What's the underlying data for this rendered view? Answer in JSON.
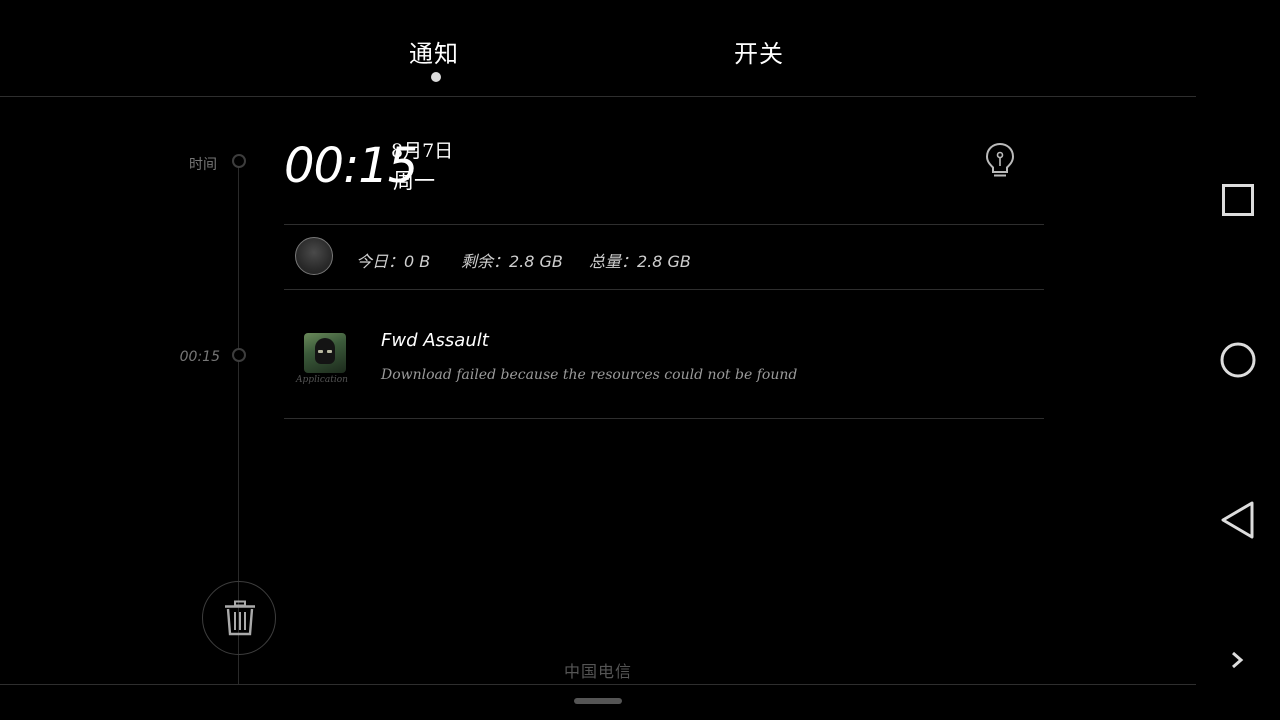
{
  "tabs": {
    "notifications": "通知",
    "switches": "开关"
  },
  "timeline": {
    "time_label": "时间",
    "entry_time": "00:15"
  },
  "header": {
    "time": "00:15",
    "date": "8月7日",
    "weekday": "周一"
  },
  "storage": {
    "today": "今日：0 B",
    "remaining": "剩余：2.8 GB",
    "total": "总量：2.8 GB"
  },
  "notification": {
    "title": "Fwd Assault",
    "message": "Download failed because the resources could not be found",
    "icon_caption": "Application"
  },
  "footer": {
    "carrier": "中国电信"
  },
  "icons": {
    "bulb": "lightbulb-icon",
    "trash": "trash-icon",
    "recents": "square-icon",
    "home": "circle-icon",
    "back": "triangle-back-icon",
    "more": "chevron-right-icon"
  }
}
